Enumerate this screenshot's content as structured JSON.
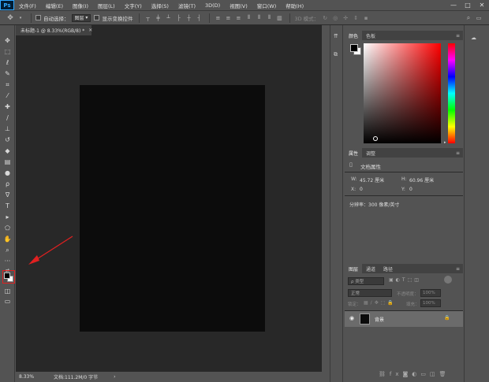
{
  "app": {
    "logo": "Ps"
  },
  "menu": [
    "文件(F)",
    "编辑(E)",
    "图像(I)",
    "图层(L)",
    "文字(Y)",
    "选择(S)",
    "滤镜(T)",
    "3D(D)",
    "视图(V)",
    "窗口(W)",
    "帮助(H)"
  ],
  "window_controls": {
    "minimize": "—",
    "maximize": "□",
    "close": "✕"
  },
  "options_bar": {
    "auto_select_label": "自动选择：",
    "auto_select_value": "图层",
    "show_transform_label": "显示变换控件",
    "mode_3d_label": "3D 模式："
  },
  "document": {
    "tab_title": "未标题-1 @ 8.33%(RGB/8) *",
    "zoom": "8.33%",
    "doc_info": "文档:111.2M/0 字节",
    "canvas_color": "#0c0c0c"
  },
  "color_panel": {
    "tabs": [
      "颜色",
      "色板"
    ],
    "foreground": "#000000",
    "background": "#ffffff",
    "hue": "#ff0000"
  },
  "properties_panel": {
    "tabs": [
      "属性",
      "调整"
    ],
    "title": "文档属性",
    "w_label": "W:",
    "w_value": "45.72 厘米",
    "h_label": "H:",
    "h_value": "60.96 厘米",
    "x_label": "X:",
    "x_value": "0",
    "y_label": "Y:",
    "y_value": "0",
    "resolution": "分辨率：300 像素/英寸"
  },
  "layers_panel": {
    "tabs": [
      "图层",
      "通道",
      "路径"
    ],
    "filter_kind": "ρ 类型",
    "blend_mode": "正常",
    "opacity_label": "不透明度：",
    "opacity_value": "100%",
    "lock_label": "锁定：",
    "fill_label": "填充：",
    "fill_value": "100%",
    "layers": [
      {
        "name": "背景",
        "thumb_color": "#0c0c0c"
      }
    ]
  },
  "annotation": {
    "arrow_color": "#e02020",
    "highlight_color": "#e02020"
  }
}
